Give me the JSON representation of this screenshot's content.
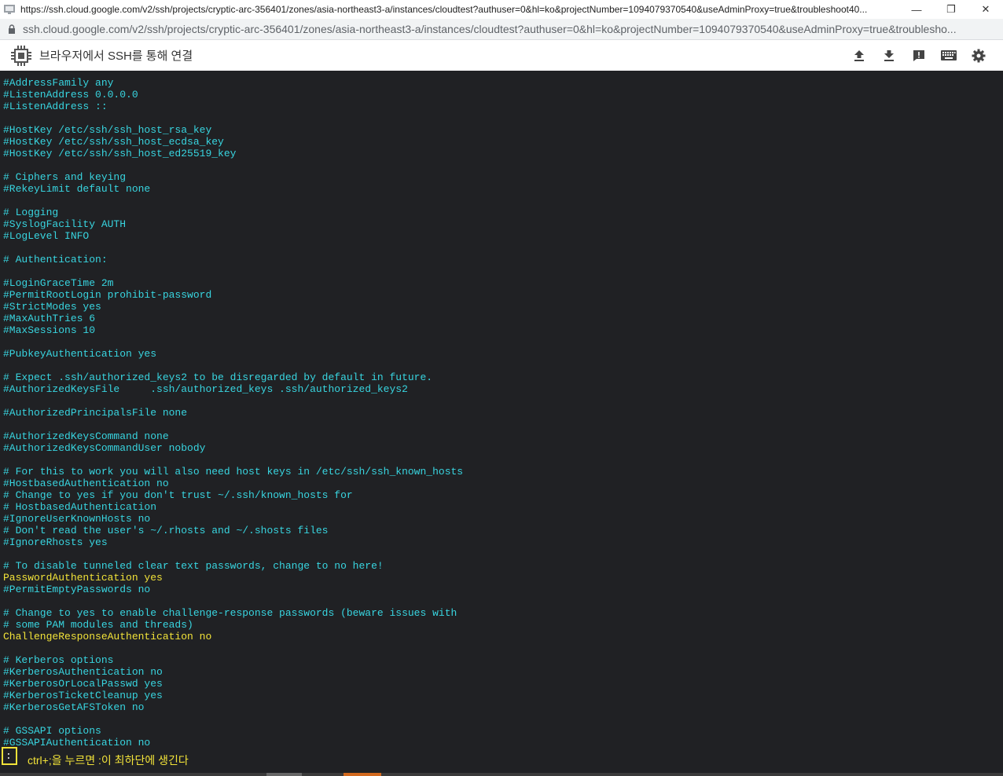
{
  "window": {
    "url_title": "https://ssh.cloud.google.com/v2/ssh/projects/cryptic-arc-356401/zones/asia-northeast3-a/instances/cloudtest?authuser=0&hl=ko&projectNumber=1094079370540&useAdminProxy=true&troubleshoot40...",
    "minimize": "—",
    "restore": "❐",
    "close": "✕"
  },
  "address": {
    "url": "ssh.cloud.google.com/v2/ssh/projects/cryptic-arc-356401/zones/asia-northeast3-a/instances/cloudtest?authuser=0&hl=ko&projectNumber=1094079370540&useAdminProxy=true&troublesho..."
  },
  "toolbar": {
    "title": "브라우저에서 SSH를 통해 연결",
    "icons": [
      "upload-icon",
      "download-icon",
      "feedback-icon",
      "keyboard-icon",
      "gear-icon"
    ]
  },
  "colors": {
    "comment": "#38d5e0",
    "active": "#f2e339",
    "background": "#202124"
  },
  "terminal": {
    "lines": [
      {
        "t": "#AddressFamily any",
        "k": "c"
      },
      {
        "t": "#ListenAddress 0.0.0.0",
        "k": "c"
      },
      {
        "t": "#ListenAddress ::",
        "k": "c"
      },
      {
        "t": "",
        "k": "c"
      },
      {
        "t": "#HostKey /etc/ssh/ssh_host_rsa_key",
        "k": "c"
      },
      {
        "t": "#HostKey /etc/ssh/ssh_host_ecdsa_key",
        "k": "c"
      },
      {
        "t": "#HostKey /etc/ssh/ssh_host_ed25519_key",
        "k": "c"
      },
      {
        "t": "",
        "k": "c"
      },
      {
        "t": "# Ciphers and keying",
        "k": "c"
      },
      {
        "t": "#RekeyLimit default none",
        "k": "c"
      },
      {
        "t": "",
        "k": "c"
      },
      {
        "t": "# Logging",
        "k": "c"
      },
      {
        "t": "#SyslogFacility AUTH",
        "k": "c"
      },
      {
        "t": "#LogLevel INFO",
        "k": "c"
      },
      {
        "t": "",
        "k": "c"
      },
      {
        "t": "# Authentication:",
        "k": "c"
      },
      {
        "t": "",
        "k": "c"
      },
      {
        "t": "#LoginGraceTime 2m",
        "k": "c"
      },
      {
        "t": "#PermitRootLogin prohibit-password",
        "k": "c"
      },
      {
        "t": "#StrictModes yes",
        "k": "c"
      },
      {
        "t": "#MaxAuthTries 6",
        "k": "c"
      },
      {
        "t": "#MaxSessions 10",
        "k": "c"
      },
      {
        "t": "",
        "k": "c"
      },
      {
        "t": "#PubkeyAuthentication yes",
        "k": "c"
      },
      {
        "t": "",
        "k": "c"
      },
      {
        "t": "# Expect .ssh/authorized_keys2 to be disregarded by default in future.",
        "k": "c"
      },
      {
        "t": "#AuthorizedKeysFile     .ssh/authorized_keys .ssh/authorized_keys2",
        "k": "c"
      },
      {
        "t": "",
        "k": "c"
      },
      {
        "t": "#AuthorizedPrincipalsFile none",
        "k": "c"
      },
      {
        "t": "",
        "k": "c"
      },
      {
        "t": "#AuthorizedKeysCommand none",
        "k": "c"
      },
      {
        "t": "#AuthorizedKeysCommandUser nobody",
        "k": "c"
      },
      {
        "t": "",
        "k": "c"
      },
      {
        "t": "# For this to work you will also need host keys in /etc/ssh/ssh_known_hosts",
        "k": "c"
      },
      {
        "t": "#HostbasedAuthentication no",
        "k": "c"
      },
      {
        "t": "# Change to yes if you don't trust ~/.ssh/known_hosts for",
        "k": "c"
      },
      {
        "t": "# HostbasedAuthentication",
        "k": "c"
      },
      {
        "t": "#IgnoreUserKnownHosts no",
        "k": "c"
      },
      {
        "t": "# Don't read the user's ~/.rhosts and ~/.shosts files",
        "k": "c"
      },
      {
        "t": "#IgnoreRhosts yes",
        "k": "c"
      },
      {
        "t": "",
        "k": "c"
      },
      {
        "t": "# To disable tunneled clear text passwords, change to no here!",
        "k": "c"
      },
      {
        "t": "PasswordAuthentication yes",
        "k": "a"
      },
      {
        "t": "#PermitEmptyPasswords no",
        "k": "c"
      },
      {
        "t": "",
        "k": "c"
      },
      {
        "t": "# Change to yes to enable challenge-response passwords (beware issues with",
        "k": "c"
      },
      {
        "t": "# some PAM modules and threads)",
        "k": "c"
      },
      {
        "t": "ChallengeResponseAuthentication no",
        "k": "a"
      },
      {
        "t": "",
        "k": "c"
      },
      {
        "t": "# Kerberos options",
        "k": "c"
      },
      {
        "t": "#KerberosAuthentication no",
        "k": "c"
      },
      {
        "t": "#KerberosOrLocalPasswd yes",
        "k": "c"
      },
      {
        "t": "#KerberosTicketCleanup yes",
        "k": "c"
      },
      {
        "t": "#KerberosGetAFSToken no",
        "k": "c"
      },
      {
        "t": "",
        "k": "c"
      },
      {
        "t": "# GSSAPI options",
        "k": "c"
      },
      {
        "t": "#GSSAPIAuthentication no",
        "k": "c"
      }
    ]
  },
  "status": {
    "cursor": ":",
    "hint": "ctrl+;을 누르면 :이 최하단에 생긴다"
  }
}
